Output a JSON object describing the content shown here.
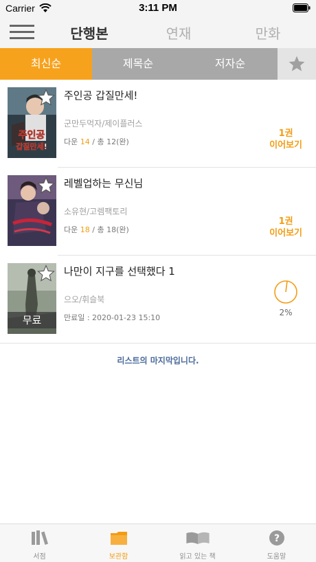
{
  "status_bar": {
    "carrier": "Carrier",
    "time": "3:11 PM"
  },
  "header": {
    "tabs": [
      "단행본",
      "연재",
      "만화"
    ]
  },
  "sort": {
    "options": [
      "최신순",
      "제목순",
      "저자순"
    ]
  },
  "books": [
    {
      "title": "주인공 갑질만세!",
      "author": "군만두먹자/제이플러스",
      "downloaded_label": "다운",
      "downloaded": "14",
      "total": "/  총 12(완)",
      "continue_volume": "1권",
      "continue_label": "이어보기"
    },
    {
      "title": "레벨업하는 무신님",
      "author": "소유현/고렘팩토리",
      "downloaded_label": "다운",
      "downloaded": "18",
      "total": "/  총 18(완)",
      "continue_volume": "1권",
      "continue_label": "이어보기"
    },
    {
      "title": "나만이 지구를 선택했다 1",
      "author": "으오/휘슬북",
      "expiry": "만료일 :  2020-01-23 15:10",
      "free_badge": "무료",
      "progress_label": "2%",
      "progress": 0.02
    }
  ],
  "list_end": "리스트의 마지막입니다.",
  "bottom_tabs": [
    "서점",
    "보관함",
    "읽고 있는 책",
    "도움말"
  ],
  "colors": {
    "accent": "#f39c12",
    "sort_active": "#f7a21c",
    "sort_bar": "#a8a8a8"
  }
}
